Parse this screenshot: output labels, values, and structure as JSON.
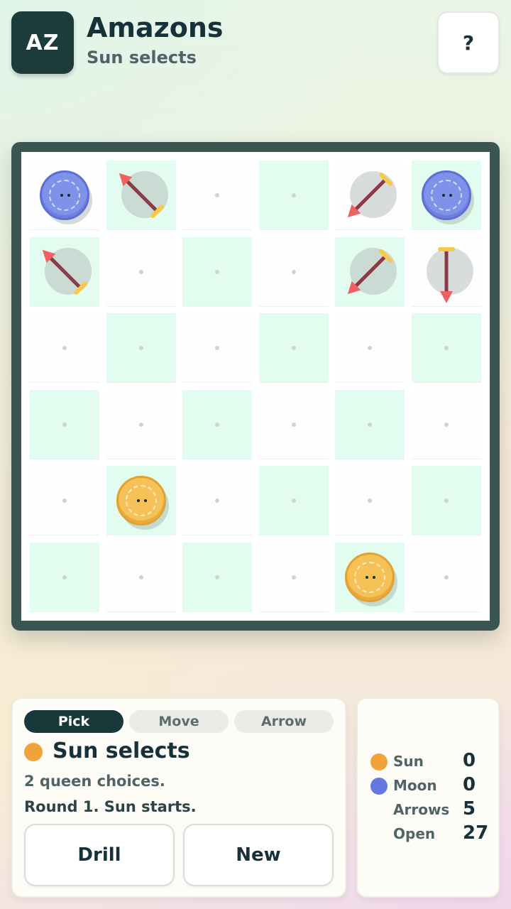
{
  "header": {
    "logo_text": "AZ",
    "title": "Amazons",
    "subtitle": "Sun selects",
    "help_label": "?"
  },
  "board": {
    "size": 6,
    "queens": [
      {
        "row": 0,
        "col": 0,
        "player": "moon"
      },
      {
        "row": 0,
        "col": 5,
        "player": "moon"
      },
      {
        "row": 4,
        "col": 1,
        "player": "sun"
      },
      {
        "row": 5,
        "col": 4,
        "player": "sun"
      }
    ],
    "arrows": [
      {
        "row": 0,
        "col": 1,
        "points": "north-west"
      },
      {
        "row": 0,
        "col": 4,
        "points": "south-west"
      },
      {
        "row": 1,
        "col": 0,
        "points": "north-west"
      },
      {
        "row": 1,
        "col": 4,
        "points": "south-west"
      },
      {
        "row": 1,
        "col": 5,
        "points": "south"
      }
    ]
  },
  "phases": [
    {
      "label": "Pick",
      "active": true
    },
    {
      "label": "Move",
      "active": false
    },
    {
      "label": "Arrow",
      "active": false
    }
  ],
  "status": {
    "title": "Sun selects",
    "line1": "2 queen choices.",
    "line2": "Round 1. Sun starts.",
    "color": "#f0a33a"
  },
  "buttons": {
    "drill": "Drill",
    "new": "New"
  },
  "stats": [
    {
      "label": "Sun",
      "value": "0",
      "color": "#f0a33a"
    },
    {
      "label": "Moon",
      "value": "0",
      "color": "#6677dd"
    },
    {
      "label": "Arrows",
      "value": "5",
      "color": ""
    },
    {
      "label": "Open",
      "value": "27",
      "color": ""
    }
  ],
  "colors": {
    "sun": "#f6c257",
    "moon": "#7f92ea",
    "frame": "#3a5552",
    "dark_square": "#e2fcef",
    "arrow_shaft": "#8b3a45",
    "arrow_head": "#f06060",
    "arrow_fletch": "#f7c948"
  },
  "icons": {
    "arrow_piece": "arrow-icon",
    "queen_piece": "queen-token-icon"
  }
}
